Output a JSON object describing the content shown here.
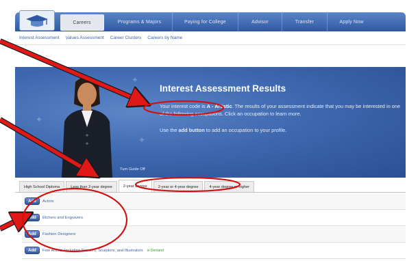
{
  "nav": {
    "tabs": [
      {
        "label": "Careers",
        "active": true
      },
      {
        "label": "Programs & Majors",
        "active": false
      },
      {
        "label": "Paying for College",
        "active": false
      },
      {
        "label": "Advisor",
        "active": false
      },
      {
        "label": "Transfer",
        "active": false
      },
      {
        "label": "Apply Now",
        "active": false
      }
    ],
    "logo_icon": "grad-cap-logo-icon"
  },
  "subnav": {
    "links": [
      "Interest Assessment",
      "Values Assessment",
      "Career Clusters",
      "Careers by Name"
    ]
  },
  "hero": {
    "title": "Interest Assessment Results",
    "intro_prefix": "Your interest code is ",
    "interest_code": "A - Artistic",
    "intro_suffix": ". The results of your assessment indicate that you may be interested in one of the following occupations. Click an occupation to learn more.",
    "add_prefix": "Use the ",
    "add_bold": "add button",
    "add_suffix": " to add an occupation to your profile.",
    "guide_toggle": "Turn Guide Off"
  },
  "degree_tabs": [
    {
      "label": "High School Diploma",
      "active": false
    },
    {
      "label": "Less than 2-year degree",
      "active": false
    },
    {
      "label": "2-year degree",
      "active": true
    },
    {
      "label": "2-year or 4-year degree",
      "active": false
    },
    {
      "label": "4-year degree or higher",
      "active": false
    }
  ],
  "occupations": {
    "add_label": "Add",
    "items": [
      {
        "name": "Actors",
        "tag": ""
      },
      {
        "name": "Etchers and Engravers",
        "tag": ""
      },
      {
        "name": "Fashion Designers",
        "tag": ""
      },
      {
        "name": "Fine Artists, Including Painters, Sculptors, and Illustrators",
        "tag": "in Demand"
      }
    ]
  },
  "colors": {
    "nav_blue": "#2f58a2",
    "hero_blue": "#3e68b0",
    "link_blue": "#3b5fa8",
    "arrow_red": "#e01818",
    "circle_red": "#d11010"
  }
}
